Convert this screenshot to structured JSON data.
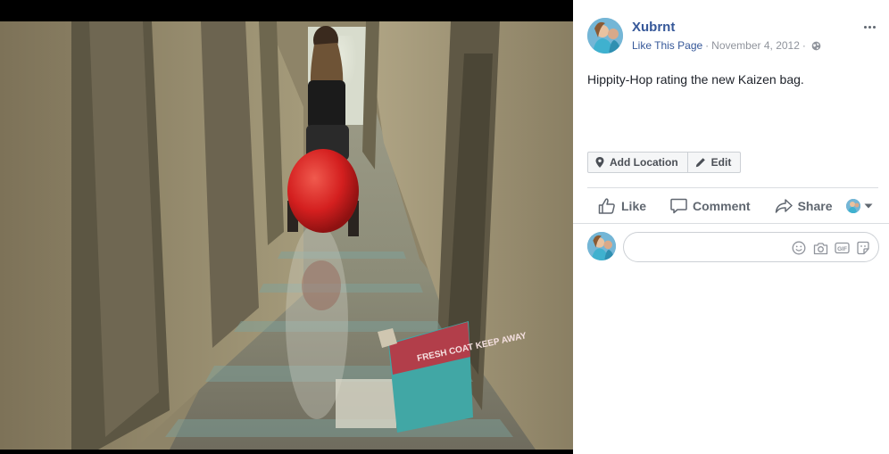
{
  "post": {
    "page_name": "Xubrnt",
    "like_page_label": "Like This Page",
    "separator": "·",
    "date": "November 4, 2012",
    "caption": "Hippity-Hop rating the new Kaizen bag."
  },
  "tags": {
    "add_location_label": "Add Location",
    "edit_label": "Edit"
  },
  "actions": {
    "like_label": "Like",
    "comment_label": "Comment",
    "share_label": "Share"
  },
  "comment_box": {
    "placeholder": "",
    "tools": [
      "emoji-icon",
      "camera-icon",
      "gif-icon",
      "sticker-icon"
    ]
  },
  "photo": {
    "sign_text": "FRESH COAT KEEP AWAY"
  },
  "colors": {
    "link": "#365899",
    "muted": "#90949c",
    "text": "#1d2129",
    "action_text": "#606770",
    "border": "#ccd0d5",
    "ball": "#d41f1f",
    "floor": "#8f8f7a"
  }
}
